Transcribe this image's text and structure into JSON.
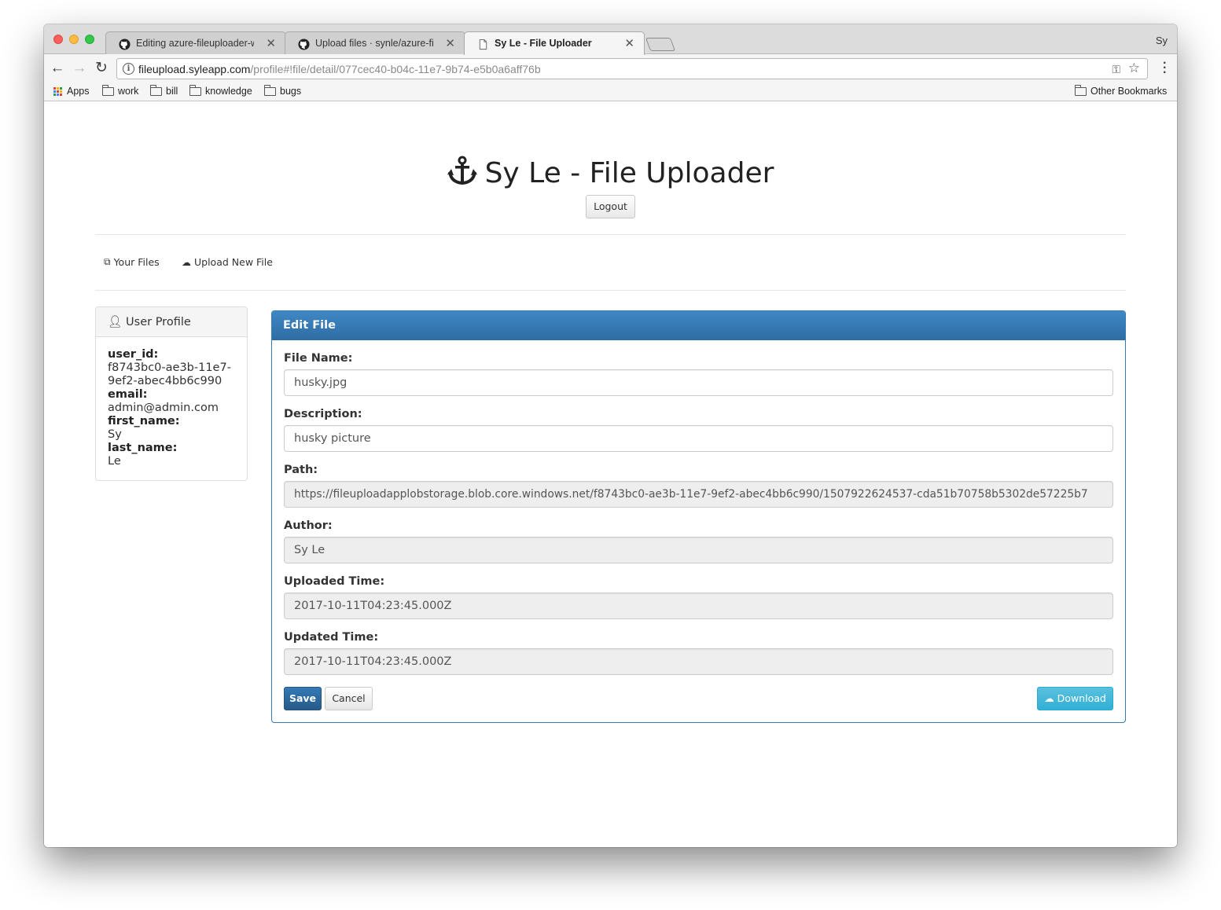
{
  "browser": {
    "tabs": [
      {
        "title": "Editing azure-fileuploader-web",
        "icon": "github-icon",
        "active": false
      },
      {
        "title": "Upload files · synle/azure-fileu",
        "icon": "github-icon",
        "active": false
      },
      {
        "title": "Sy Le - File Uploader",
        "icon": "page-icon",
        "active": true
      }
    ],
    "profile_name": "Sy",
    "url_host": "fileupload.syleapp.com",
    "url_path": "/profile#!file/detail/077cec40-b04c-11e7-9b74-e5b0a6aff76b",
    "bookmarks": [
      {
        "label": "Apps",
        "icon": "apps-icon"
      },
      {
        "label": "work",
        "icon": "folder-icon"
      },
      {
        "label": "bill",
        "icon": "folder-icon"
      },
      {
        "label": "knowledge",
        "icon": "folder-icon"
      },
      {
        "label": "bugs",
        "icon": "folder-icon"
      }
    ],
    "other_bookmarks": "Other Bookmarks"
  },
  "header": {
    "title": "Sy Le - File Uploader",
    "logout_label": "Logout"
  },
  "nav": {
    "your_files": "Your Files",
    "upload_new_file": "Upload New File"
  },
  "profile": {
    "heading": "User Profile",
    "user_id_label": "user_id:",
    "user_id": "f8743bc0-ae3b-11e7-9ef2-abec4bb6c990",
    "email_label": "email:",
    "email": "admin@admin.com",
    "first_name_label": "first_name:",
    "first_name": "Sy",
    "last_name_label": "last_name:",
    "last_name": "Le"
  },
  "edit_file": {
    "heading": "Edit File",
    "file_name_label": "File Name:",
    "file_name": "husky.jpg",
    "description_label": "Description:",
    "description": "husky picture",
    "path_label": "Path:",
    "path": "https://fileuploadapplobstorage.blob.core.windows.net/f8743bc0-ae3b-11e7-9ef2-abec4bb6c990/1507922624537-cda51b70758b5302de57225b7",
    "author_label": "Author:",
    "author": "Sy Le",
    "uploaded_label": "Uploaded Time:",
    "uploaded": "2017-10-11T04:23:45.000Z",
    "updated_label": "Updated Time:",
    "updated": "2017-10-11T04:23:45.000Z",
    "save_label": "Save",
    "cancel_label": "Cancel",
    "download_label": "Download"
  },
  "colors": {
    "primary": "#337ab7",
    "info": "#5bc0de",
    "panel_border": "#dddddd"
  }
}
